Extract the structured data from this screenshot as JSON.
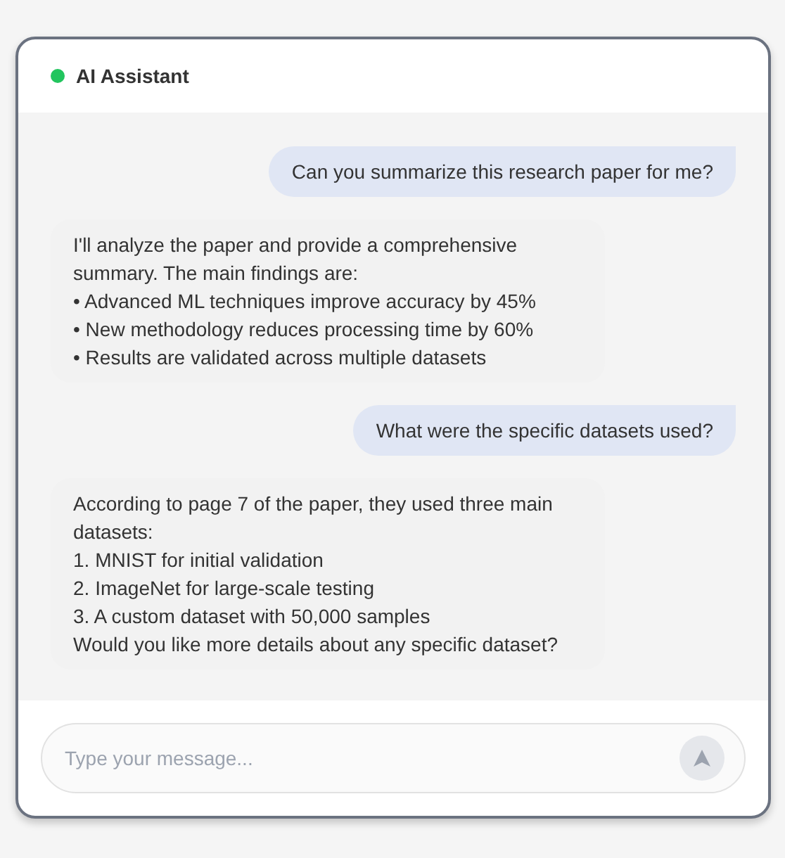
{
  "header": {
    "title": "AI Assistant",
    "color": "#22c55e"
  },
  "messages": [
    {
      "kind": "user",
      "lines": [
        "Can you summarize this research paper for me?"
      ]
    },
    {
      "kind": "assistant",
      "lines": [
        "I'll analyze the paper and provide a comprehensive summary. The main findings are:",
        "• Advanced ML techniques improve accuracy by 45%",
        "• New methodology reduces processing time by 60%",
        "• Results are validated across multiple datasets"
      ]
    },
    {
      "kind": "user",
      "lines": [
        "What were the specific datasets used?"
      ]
    },
    {
      "kind": "assistant",
      "lines": [
        "According to page 7 of the paper, they used three main datasets:",
        "1. MNIST for initial validation",
        "2. ImageNet for large-scale testing",
        "3. A custom dataset with 50,000 samples",
        "Would you like more details about any specific dataset?"
      ]
    }
  ],
  "composer": {
    "placeholder": "Type your message...",
    "send_disabled": true
  }
}
